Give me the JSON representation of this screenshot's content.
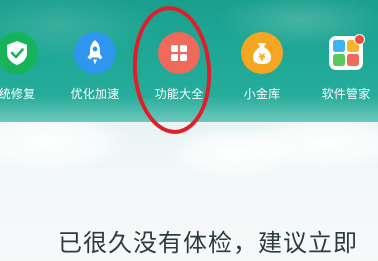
{
  "toolbar": {
    "items": [
      {
        "label": "统修复",
        "icon": "shield-check-icon",
        "color": "#16b35a"
      },
      {
        "label": "优化加速",
        "icon": "rocket-icon",
        "color": "#2f96f0"
      },
      {
        "label": "功能大全",
        "icon": "app-grid-icon",
        "color": "#f06a5b"
      },
      {
        "label": "小金库",
        "icon": "money-bag-icon",
        "color": "#f5a623"
      },
      {
        "label": "软件管家",
        "icon": "software-manager-icon",
        "color": "#ffffff"
      }
    ]
  },
  "annotation": {
    "color": "#e01e2b"
  },
  "status": {
    "message": "已很久没有体检，建议立即"
  }
}
